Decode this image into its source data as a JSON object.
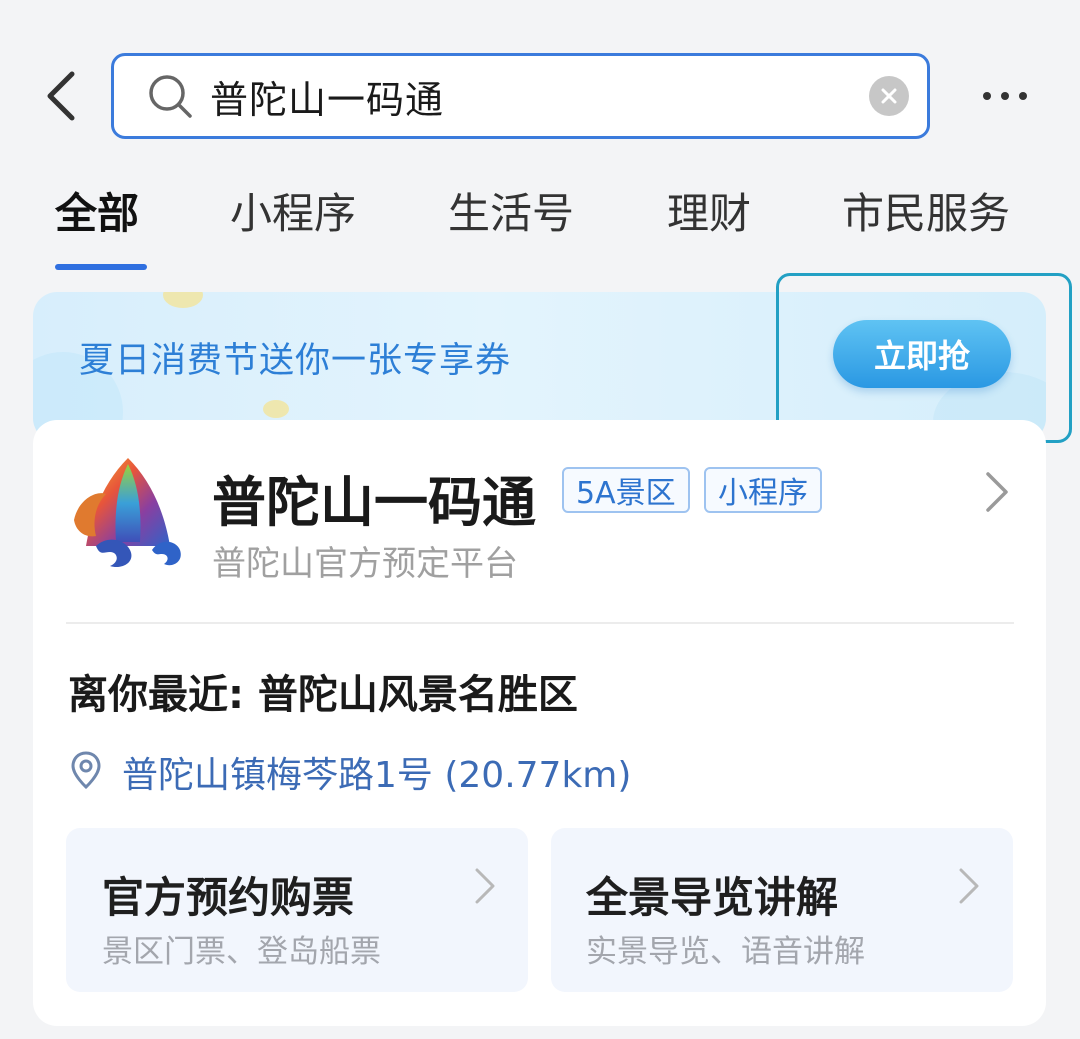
{
  "header": {
    "search_value": "普陀山一码通"
  },
  "tabs": [
    {
      "label": "全部",
      "active": true
    },
    {
      "label": "小程序",
      "active": false
    },
    {
      "label": "生活号",
      "active": false
    },
    {
      "label": "理财",
      "active": false
    },
    {
      "label": "市民服务",
      "active": false
    }
  ],
  "promo": {
    "text": "夏日消费节送你一张专享券",
    "button_label": "立即抢"
  },
  "result": {
    "title": "普陀山一码通",
    "tags": [
      "5A景区",
      "小程序"
    ],
    "subtitle": "普陀山官方预定平台",
    "nearest": "离你最近: 普陀山风景名胜区",
    "address": "普陀山镇梅芩路1号 (20.77km)",
    "services": [
      {
        "title": "官方预约购票",
        "subtitle": "景区门票、登岛船票"
      },
      {
        "title": "全景导览讲解",
        "subtitle": "实景导览、语音讲解"
      }
    ]
  },
  "colors": {
    "accent": "#2f6fe0",
    "promo_text": "#2d7fd6",
    "highlight": "#22a0c4"
  }
}
